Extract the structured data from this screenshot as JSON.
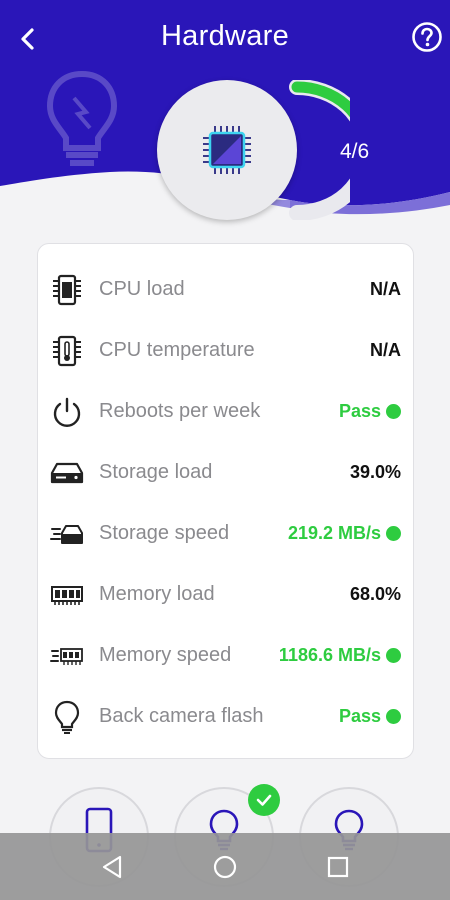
{
  "header": {
    "title": "Hardware",
    "back_icon": "chevron-left-icon",
    "help_icon": "help-circle-icon",
    "progress_text": "4/6",
    "progress_fraction": 0.667,
    "colors": {
      "primary": "#2a16b8",
      "accent_green": "#2ecc40",
      "wave": "#7c6fd8"
    }
  },
  "items": [
    {
      "label": "CPU load",
      "value": "N/A",
      "status": "plain",
      "icon": "cpu-chip-icon"
    },
    {
      "label": "CPU temperature",
      "value": "N/A",
      "status": "plain",
      "icon": "thermometer-chip-icon"
    },
    {
      "label": "Reboots per week",
      "value": "Pass",
      "status": "pass",
      "icon": "power-icon"
    },
    {
      "label": "Storage load",
      "value": "39.0%",
      "status": "plain",
      "icon": "hard-drive-icon"
    },
    {
      "label": "Storage speed",
      "value": "219.2 MB/s",
      "status": "pass",
      "icon": "storage-speed-icon"
    },
    {
      "label": "Memory load",
      "value": "68.0%",
      "status": "plain",
      "icon": "memory-icon"
    },
    {
      "label": "Memory speed",
      "value": "1186.6 MB/s",
      "status": "pass",
      "icon": "memory-speed-icon"
    },
    {
      "label": "Back camera flash",
      "value": "Pass",
      "status": "pass",
      "icon": "lightbulb-icon"
    }
  ],
  "bottom_buttons": [
    {
      "icon": "phone-icon",
      "checked": false
    },
    {
      "icon": "lightbulb-icon",
      "checked": true
    },
    {
      "icon": "lightbulb-icon",
      "checked": false
    }
  ],
  "navbar": {
    "back": "nav-back-icon",
    "home": "nav-home-icon",
    "recents": "nav-recents-icon"
  }
}
